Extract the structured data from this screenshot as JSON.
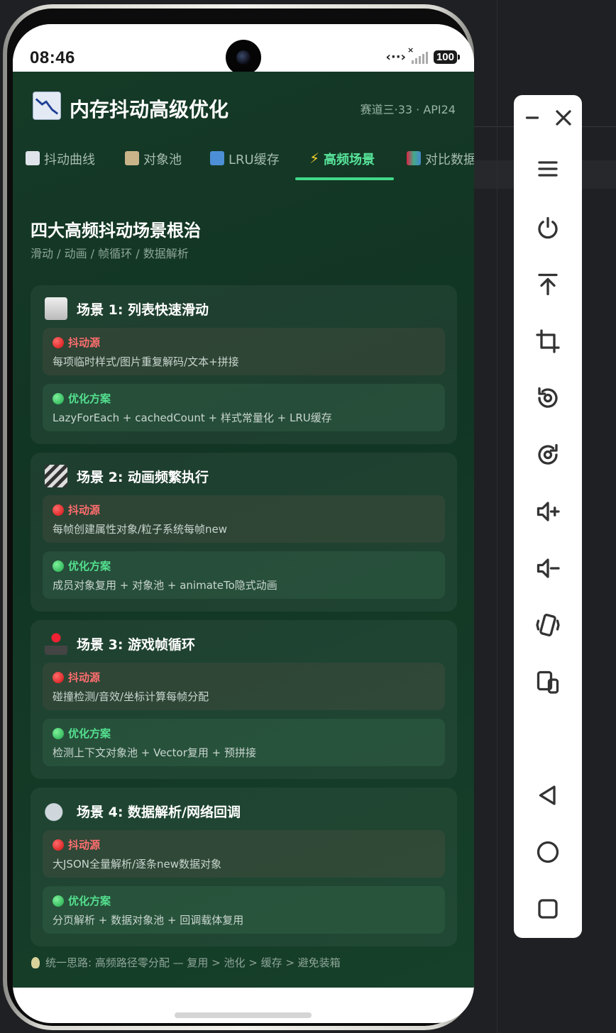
{
  "status_bar": {
    "time": "08:46",
    "battery": "100"
  },
  "app": {
    "title": "内存抖动高级优化",
    "subtitle": "赛道三·33 · API24"
  },
  "tabs": [
    {
      "label": "抖动曲线",
      "icon": "chart-trend-icon",
      "active": false
    },
    {
      "label": "对象池",
      "icon": "file-box-icon",
      "active": false
    },
    {
      "label": "LRU缓存",
      "icon": "refresh-icon",
      "active": false
    },
    {
      "label": "高频场景",
      "icon": "lightning-icon",
      "active": true
    },
    {
      "label": "对比数据",
      "icon": "bar-chart-icon",
      "active": false
    }
  ],
  "section": {
    "title": "四大高频抖动场景根治",
    "subtitle": "滑动 / 动画 / 帧循环 / 数据解析"
  },
  "scenarios": [
    {
      "title": "场景 1: 列表快速滑动",
      "icon": "scroll-icon",
      "source_label": "抖动源",
      "source_text": "每项临时样式/图片重复解码/文本+拼接",
      "fix_label": "优化方案",
      "fix_text": "LazyForEach + cachedCount + 样式常量化 + LRU缓存"
    },
    {
      "title": "场景 2: 动画频繁执行",
      "icon": "clapper-icon",
      "source_label": "抖动源",
      "source_text": "每帧创建属性对象/粒子系统每帧new",
      "fix_label": "优化方案",
      "fix_text": "成员对象复用 + 对象池 + animateTo隐式动画"
    },
    {
      "title": "场景 3: 游戏帧循环",
      "icon": "joystick-icon",
      "source_label": "抖动源",
      "source_text": "碰撞检测/音效/坐标计算每帧分配",
      "fix_label": "优化方案",
      "fix_text": "检测上下文对象池 + Vector复用 + 预拼接"
    },
    {
      "title": "场景 4: 数据解析/网络回调",
      "icon": "satellite-icon",
      "source_label": "抖动源",
      "source_text": "大JSON全量解析/逐条new数据对象",
      "fix_label": "优化方案",
      "fix_text": "分页解析 + 数据对象池 + 回调载体复用"
    }
  ],
  "footer_tip": "统一思路: 高频路径零分配 — 复用 > 池化 > 缓存 > 避免装箱",
  "toolbar": [
    "minimize-icon",
    "close-icon",
    "menu-icon",
    "power-icon",
    "pin-top-icon",
    "crop-icon",
    "rotate-left-icon",
    "rotate-right-icon",
    "volume-up-icon",
    "volume-down-icon",
    "shake-icon",
    "multi-device-icon",
    "back-icon",
    "home-icon",
    "recents-icon"
  ],
  "colors": {
    "accent": "#42d98a",
    "background": "#123524",
    "source_red": "#ff6e6e",
    "fix_green": "#54e08f"
  }
}
